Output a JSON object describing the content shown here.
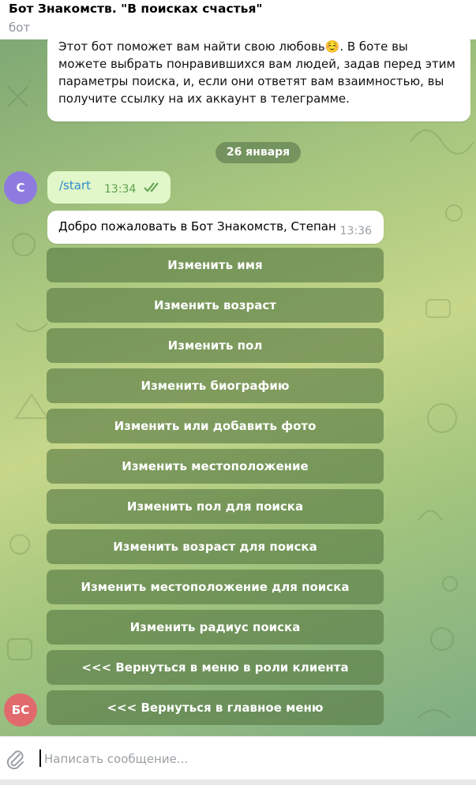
{
  "header": {
    "title": "Бот Знакомств. \"В поисках счастья\"",
    "subtitle": "бот"
  },
  "messages": {
    "intro_text": "Этот бот поможет вам найти свою любовь☺️. В боте вы можете выбрать понравившихся вам людей, задав перед этим параметры поиска, и, если они ответят вам взаимностью, вы получите ссылку на их аккаунт в телеграмме.",
    "date_separator": "26 января",
    "user_avatar_initial": "С",
    "user_command": "/start",
    "user_time": "13:34",
    "bot_welcome": "Добро пожаловать в Бот Знакомств, Степан",
    "bot_time": "13:36",
    "bot_avatar_initials": "БС"
  },
  "keyboard": {
    "buttons": [
      "Изменить имя",
      "Изменить возраст",
      "Изменить пол",
      "Изменить биографию",
      "Изменить или добавить фото",
      "Изменить местоположение",
      "Изменить пол для поиска",
      "Изменить возраст для поиска",
      "Изменить местоположение для поиска",
      "Изменить радиус поиска",
      "<<< Вернуться в меню в роли клиента",
      "<<< Вернуться в главное меню"
    ]
  },
  "composer": {
    "placeholder": "Написать сообщение..."
  },
  "colors": {
    "button_bg": "#56784280",
    "avatar_user": "#8e7be0",
    "avatar_bot": "#e16a6d",
    "link": "#2f8ad0",
    "outgoing_bubble": "#e1f7c9"
  },
  "icons": [
    "attach-icon",
    "double-check-icon"
  ]
}
